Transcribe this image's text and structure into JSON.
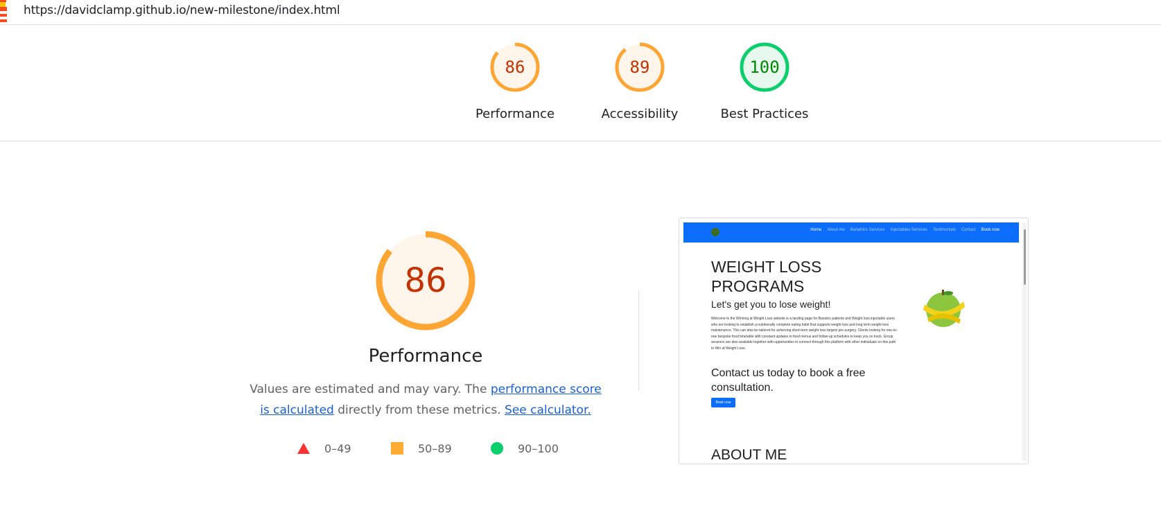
{
  "url_bar": {
    "url": "https://davidclamp.github.io/new-milestone/index.html"
  },
  "gauges": [
    {
      "label": "Performance",
      "score": "86",
      "score_value": 86,
      "rating": "average"
    },
    {
      "label": "Accessibility",
      "score": "89",
      "score_value": 89,
      "rating": "average"
    },
    {
      "label": "Best Practices",
      "score": "100",
      "score_value": 100,
      "rating": "pass"
    }
  ],
  "performance": {
    "score": "86",
    "score_value": 86,
    "title": "Performance",
    "desc_prefix": "Values are estimated and may vary. The ",
    "link_score": "performance score is calculated",
    "desc_middle": " directly from these metrics.",
    "link_calculator": "See calculator."
  },
  "legend": [
    {
      "shape": "triangle",
      "color": "#ff3333",
      "range": "0–49"
    },
    {
      "shape": "square",
      "color": "#ffaa33",
      "range": "50–89"
    },
    {
      "shape": "circle",
      "color": "#0cce6b",
      "range": "90–100"
    }
  ],
  "colors": {
    "average_stroke": "#ffa534",
    "average_fill": "#fff5ea",
    "average_text": "#c33300",
    "pass_stroke": "#0cce6b",
    "pass_fill": "#e7f8ee",
    "pass_text": "#008800",
    "link": "#1a5fd6"
  },
  "preview": {
    "nav_links": [
      "Home",
      "About me",
      "Bariatrics Services",
      "Injectables Services",
      "Testimonials",
      "Contact",
      "Book now"
    ],
    "heading": "WEIGHT LOSS PROGRAMS",
    "subheading": "Let's get you to lose weight!",
    "paragraph": "Welcome to the Winning at Weight Loss website is a landing page for Bariatric patients and Weight loss injectable users who are looking to establish a nutritionally complete eating habit that supports weight loss and long term weight-loss maintenance. This can also be tailored for achieving short-term weight loss targets pre-surgery. Clients looking for one-to-one bespoke food timetable with constant updates to food menus and follow-up schedules to keep you on track. Group sessions are also available together with opportunities to connect through this platform with other individuals on this path to Win at Weight Loss.",
    "cta": "Contact us today to book a free consultation.",
    "button": "Book now",
    "section2": "ABOUT ME"
  }
}
